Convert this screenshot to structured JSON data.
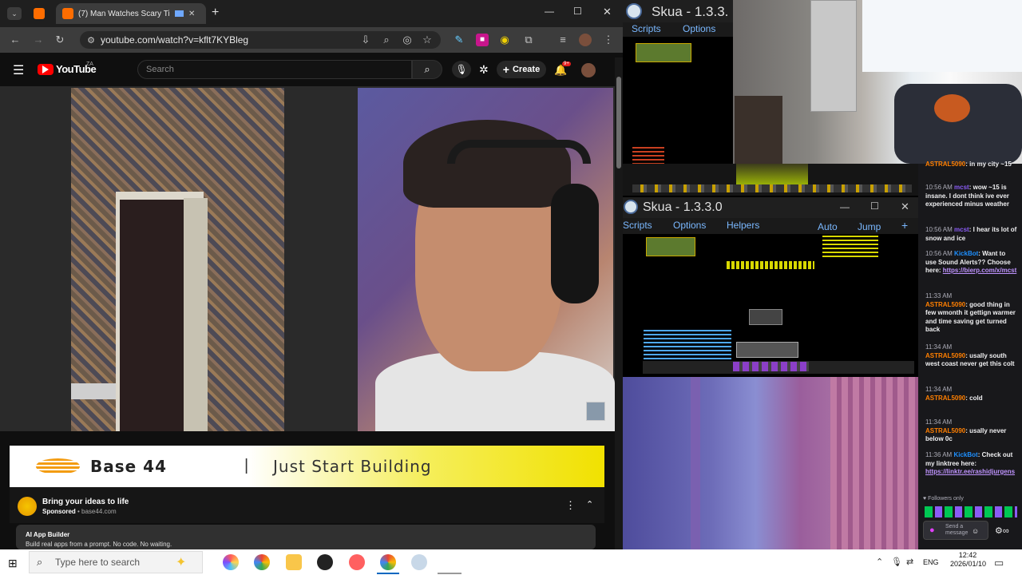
{
  "browser": {
    "tabs": [
      {
        "label": "",
        "active": false
      },
      {
        "label": "(7) Man Watches Scary TikT",
        "active": true
      }
    ],
    "new_tab": "+",
    "url": "youtube.com/watch?v=kflt7KYBleg",
    "controls": {
      "minimize": "—",
      "maximize": "☐",
      "close": "✕"
    }
  },
  "youtube": {
    "logo": "YouTube",
    "logo_sup": "ZA",
    "search_placeholder": "Search",
    "create_label": "Create",
    "notif_count": "9+",
    "ad": {
      "banner_title": "Base 44",
      "banner_sep": "|",
      "banner_tagline": "Just Start Building",
      "headline": "Bring your ideas to life",
      "sponsored": "Sponsored",
      "domain": "base44.com",
      "cta_title": "AI App Builder",
      "cta_desc": "Build real apps from a prompt. No code. No waiting."
    }
  },
  "skua1": {
    "title": "Skua - 1.3.3.",
    "menu": [
      "Scripts",
      "Options"
    ]
  },
  "skua2": {
    "title": "Skua - 1.3.3.0",
    "menu": [
      "Scripts",
      "Options",
      "Helpers",
      "Auto",
      "Jump"
    ]
  },
  "chat": {
    "messages": [
      {
        "time": "",
        "user": "ASTRAL5090",
        "text": "in my city ~15",
        "user_class": "u-astral"
      },
      {
        "time": "10:56 AM",
        "user": "mcst",
        "text": "wow ~15 is insane. I dont think ive ever experienced minus weather",
        "user_class": "u-mcst"
      },
      {
        "time": "10:56 AM",
        "user": "mcst",
        "text": "I hear its lot of snow and ice",
        "user_class": "u-mcst"
      },
      {
        "time": "10:56 AM",
        "user": "KickBot",
        "text": "Want to use Sound Alerts?? Choose here:",
        "link": "https://bierp.com/x/mcst",
        "user_class": "u-kick"
      },
      {
        "time": "11:33 AM",
        "user": "ASTRAL5090",
        "text": "good thing in few wmonth it gettign warmer and time saving get turned back",
        "user_class": "u-astral"
      },
      {
        "time": "11:34 AM",
        "user": "ASTRAL5090",
        "text": "usally south west coast never get this colt",
        "user_class": "u-astral"
      },
      {
        "time": "11:34 AM",
        "user": "ASTRAL5090",
        "text": "cold",
        "user_class": "u-astral"
      },
      {
        "time": "11:34 AM",
        "user": "ASTRAL5090",
        "text": "usally never below 0c",
        "user_class": "u-astral"
      },
      {
        "time": "11:36 AM",
        "user": "KickBot",
        "text": "Check out my linktree here:",
        "link": "https://linktr.ee/rashidjurgen",
        "link_tail": "s",
        "user_class": "u-kick"
      }
    ],
    "followers_only": "Followers only",
    "send_placeholder": "Send a message"
  },
  "taskbar": {
    "search_placeholder": "Type here to search",
    "lang": "ENG",
    "time": "12:42",
    "date": "2026/01/10"
  },
  "colors": {
    "youtube_red": "#ff0000",
    "chat_bg": "#18181b",
    "ad_yellow": "#f1e100"
  }
}
